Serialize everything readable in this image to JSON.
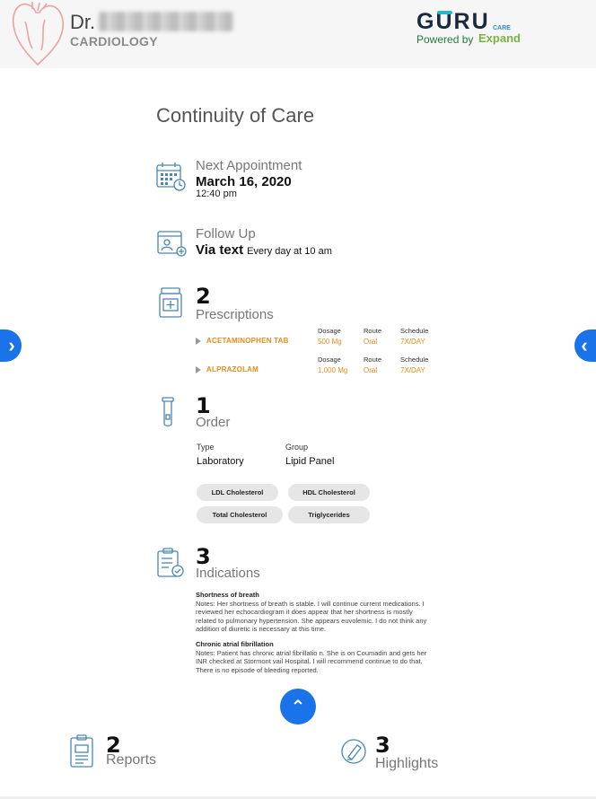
{
  "header": {
    "doctor_prefix": "Dr.",
    "specialty": "CARDIOLOGY",
    "brand": {
      "g": "G",
      "o": "U",
      "rest": "RU",
      "powered_by": "Powered by",
      "expand_care": "CARE",
      "expand": "Expand"
    }
  },
  "page_title": "Continuity of Care",
  "appointment": {
    "label": "Next Appointment",
    "date": "March 16, 2020",
    "time": "12:40 pm"
  },
  "follow_up": {
    "label": "Follow Up",
    "method": "Via text",
    "schedule": "Every day at 10 am"
  },
  "prescriptions": {
    "count": "2",
    "label": "Prescriptions",
    "headers": {
      "dosage": "Dosage",
      "route": "Route",
      "schedule": "Schedule"
    },
    "items": [
      {
        "name": "ACETAMINOPHEN TAB",
        "dosage": "500 Mg",
        "route": "Oral",
        "schedule": "7X/DAY"
      },
      {
        "name": "ALPRAZOLAM",
        "dosage": "1,000 Mg",
        "route": "Oral",
        "schedule": "7X/DAY"
      }
    ]
  },
  "order": {
    "count": "1",
    "label": "Order",
    "type_header": "Type",
    "type_value": "Laboratory",
    "group_header": "Group",
    "group_value": "Lipid Panel",
    "tests": [
      "LDL Cholesterol",
      "HDL Cholesterol",
      "Total Cholesterol",
      "Triglycerides"
    ]
  },
  "indications": {
    "count": "3",
    "label": "Indications",
    "items": [
      {
        "title": "Shortness of breath",
        "notes": "Notes: Her shortness of breath is stable. I will continue current medications. I reviewed her echocardiogram it does appear that her shortness is mostly related to pulmonary hypertension. She appears euvolemic. I do not think any addition of diuretic is necessary at this time."
      },
      {
        "title": "Chronic atrial fibrillation",
        "notes": "Notes: Patient has chronic atrial fibrillatio n. She is on Coumadin and gets her INR checked at Stormont vail Hospital. I will recommend continue to do that. There is no episode of bleeding reported."
      }
    ]
  },
  "footer": {
    "reports": {
      "count": "2",
      "label": "Reports"
    },
    "highlights": {
      "count": "3",
      "label": "Highlights"
    }
  },
  "nav": {
    "prev_glyph": "‹",
    "next_glyph": "›",
    "up_glyph": "⌃"
  },
  "colors": {
    "accent": "#1a73e8",
    "drug": "#e88b1c",
    "chip": "#e6e6e6",
    "icon": "#4a86b5"
  }
}
